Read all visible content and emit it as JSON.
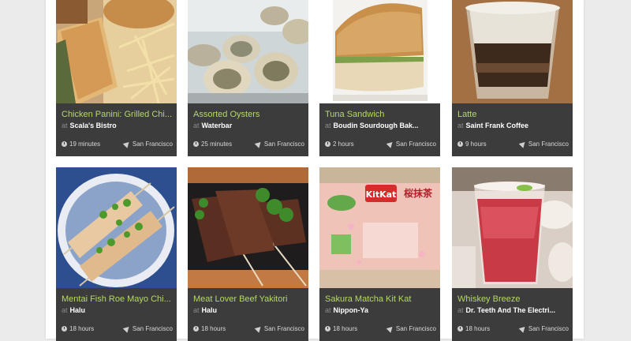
{
  "cards": [
    {
      "title": "Chicken Panini: Grilled Chi...",
      "venue_prefix": "at",
      "venue": "Scala's Bistro",
      "time": "19 minutes",
      "location": "San Francisco"
    },
    {
      "title": "Assorted Oysters",
      "venue_prefix": "at",
      "venue": "Waterbar",
      "time": "25 minutes",
      "location": "San Francisco"
    },
    {
      "title": "Tuna Sandwich",
      "venue_prefix": "at",
      "venue": "Boudin Sourdough Bak...",
      "time": "2 hours",
      "location": "San Francisco"
    },
    {
      "title": "Latte",
      "venue_prefix": "at",
      "venue": "Saint Frank Coffee",
      "time": "9 hours",
      "location": "San Francisco"
    },
    {
      "title": "Mentai Fish Roe Mayo Chi...",
      "venue_prefix": "at",
      "venue": "Halu",
      "time": "18 hours",
      "location": "San Francisco"
    },
    {
      "title": "Meat Lover Beef Yakitori",
      "venue_prefix": "at",
      "venue": "Halu",
      "time": "18 hours",
      "location": "San Francisco"
    },
    {
      "title": "Sakura Matcha Kit Kat",
      "venue_prefix": "at",
      "venue": "Nippon-Ya",
      "time": "18 hours",
      "location": "San Francisco"
    },
    {
      "title": "Whiskey Breeze",
      "venue_prefix": "at",
      "venue": "Dr. Teeth And The Electri...",
      "time": "18 hours",
      "location": "San Francisco"
    }
  ],
  "photo_labels": {
    "kitkat_brand": "KitKat",
    "kitkat_kanji": "桜抹茶"
  },
  "colors": {
    "title": "#b5d86a",
    "card_bg": "#3c3c3c",
    "page_bg": "#ebebeb"
  }
}
